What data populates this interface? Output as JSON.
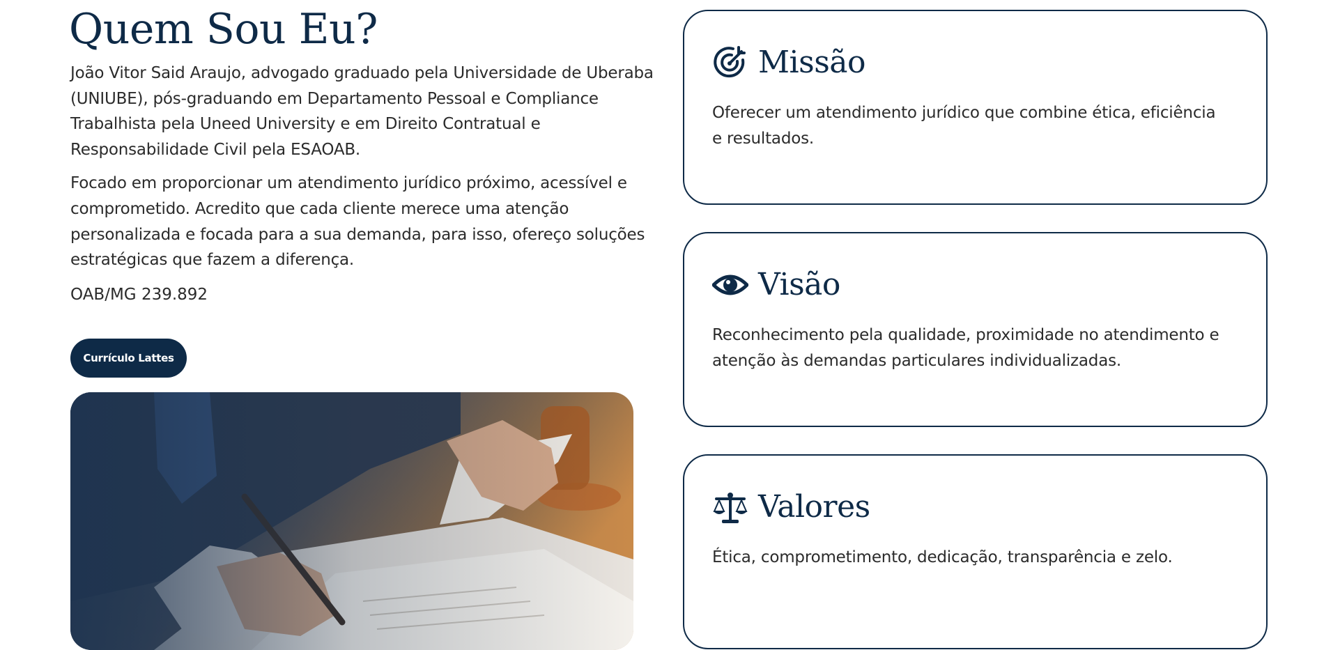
{
  "about": {
    "title": "Quem Sou Eu?",
    "paragraphs": [
      "João Vitor Said Araujo, advogado graduado pela Universidade de Uberaba (UNIUBE), pós-graduando em Departamento Pessoal e Compliance Trabalhista pela Uneed University e em Direito Contratual e Responsabilidade Civil pela ESAOAB.",
      "Focado em proporcionar um atendimento jurídico próximo, acessível e comprometido. Acredito que cada cliente merece uma atenção personalizada e focada para a sua demanda, para isso, ofereço soluções estratégicas que fazem a diferença."
    ],
    "oab": "OAB/MG 239.892",
    "button_label": "Currículo Lattes"
  },
  "cards": [
    {
      "icon": "target-icon",
      "title": "Missão",
      "text": "Oferecer um atendimento jurídico que combine ética, eficiência e resultados."
    },
    {
      "icon": "eye-icon",
      "title": "Visão",
      "text": "Reconhecimento pela qualidade, proximidade no atendimento e atenção às demandas particulares individualizadas."
    },
    {
      "icon": "scale-icon",
      "title": "Valores",
      "text": "Ética, comprometimento, dedicação, transparência e zelo."
    }
  ],
  "colors": {
    "primary": "#0e2a47",
    "text": "#2b2b2b",
    "background": "#ffffff"
  }
}
